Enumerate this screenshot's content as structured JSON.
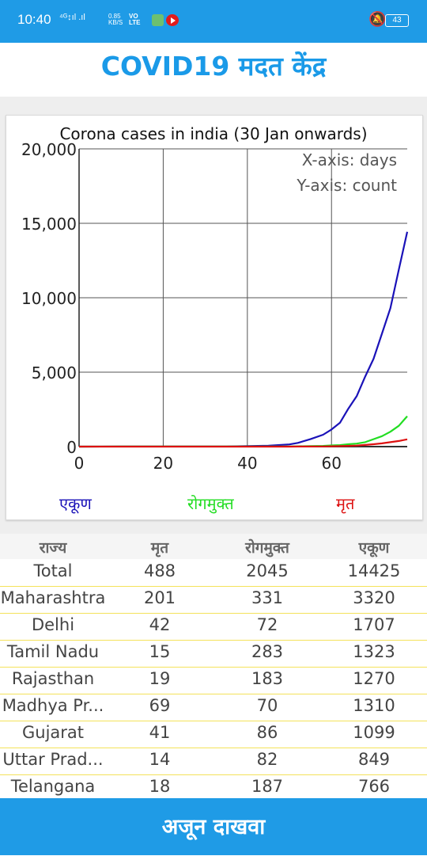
{
  "status_bar": {
    "time": "10:40",
    "signal_text": "⁴ᴳ↕ıl .ıl",
    "net_speed": "0.85",
    "net_unit": "KB/S",
    "vo_text": "VO",
    "lte_text": "LTE",
    "battery": "43"
  },
  "header": {
    "title": "COVID19 मदत केंद्र"
  },
  "chart": {
    "title": "Corona cases in india (30 Jan onwards)",
    "note_x": "X-axis: days",
    "note_y": "Y-axis: count",
    "legend": {
      "total": "एकूण",
      "recovered": "रोगमुक्त",
      "deaths": "मृत"
    }
  },
  "chart_data": {
    "type": "line",
    "title": "Corona cases in india (30 Jan onwards)",
    "xlabel": "X-axis: days",
    "ylabel": "Y-axis: count",
    "xlim": [
      0,
      78
    ],
    "ylim": [
      0,
      20000
    ],
    "x_ticks": [
      "0",
      "20",
      "40",
      "60"
    ],
    "y_ticks": [
      "0",
      "5,000",
      "10,000",
      "15,000",
      "20,000"
    ],
    "grid": true,
    "legend_position": "bottom",
    "colors": {
      "total": "#1a12b8",
      "recovered": "#22dd22",
      "deaths": "#dd1111"
    },
    "x": [
      0,
      10,
      20,
      30,
      35,
      40,
      45,
      50,
      52,
      55,
      58,
      60,
      62,
      64,
      66,
      68,
      70,
      72,
      74,
      76,
      78
    ],
    "series": [
      {
        "name": "एकूण",
        "key": "total",
        "values": [
          1,
          3,
          3,
          3,
          5,
          30,
          60,
          150,
          250,
          500,
          800,
          1150,
          1600,
          2550,
          3400,
          4700,
          5900,
          7600,
          9300,
          11900,
          14425
        ]
      },
      {
        "name": "रोगमुक्त",
        "key": "recovered",
        "values": [
          0,
          3,
          3,
          3,
          3,
          3,
          3,
          10,
          20,
          30,
          50,
          80,
          100,
          160,
          200,
          300,
          500,
          700,
          1000,
          1400,
          2045
        ]
      },
      {
        "name": "मृत",
        "key": "deaths",
        "values": [
          0,
          0,
          0,
          0,
          0,
          0,
          0,
          2,
          3,
          5,
          10,
          20,
          30,
          50,
          70,
          110,
          160,
          220,
          300,
          380,
          488
        ]
      }
    ]
  },
  "table": {
    "headers": [
      "राज्य",
      "मृत",
      "रोगमुक्त",
      "एकूण"
    ],
    "rows": [
      [
        "Total",
        "488",
        "2045",
        "14425"
      ],
      [
        "Maharashtra",
        "201",
        "331",
        "3320"
      ],
      [
        "Delhi",
        "42",
        "72",
        "1707"
      ],
      [
        "Tamil Nadu",
        "15",
        "283",
        "1323"
      ],
      [
        "Rajasthan",
        "19",
        "183",
        "1270"
      ],
      [
        "Madhya Pr...",
        "69",
        "70",
        "1310"
      ],
      [
        "Gujarat",
        "41",
        "86",
        "1099"
      ],
      [
        "Uttar Prad...",
        "14",
        "82",
        "849"
      ],
      [
        "Telangana",
        "18",
        "187",
        "766"
      ]
    ]
  },
  "footer": {
    "show_more_label": "अजून दाखवा"
  }
}
